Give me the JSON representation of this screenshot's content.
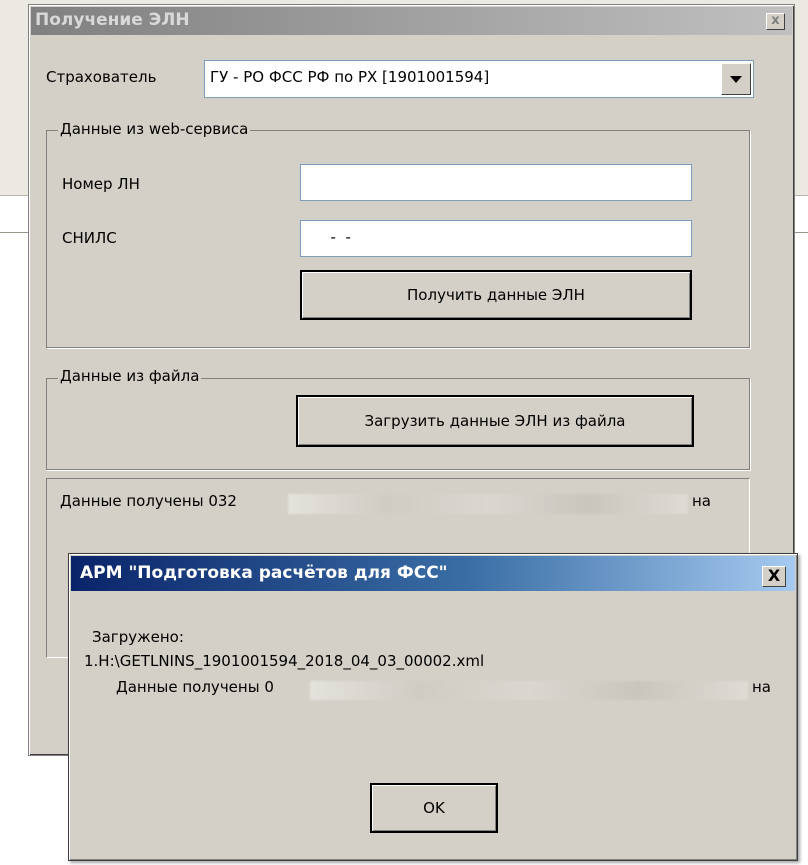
{
  "main_window": {
    "title": "Получение ЭЛН",
    "close_label": "x",
    "insurer": {
      "label": "Страхователь",
      "value": "ГУ - РО ФСС РФ по РХ [1901001594]"
    },
    "web_group": {
      "title": "Данные из web-сервиса",
      "ln_number_label": "Номер ЛН",
      "ln_number_value": "",
      "snils_label": "СНИЛС",
      "snils_value": "  -  -",
      "get_button": "Получить данные ЭЛН"
    },
    "file_group": {
      "title": "Данные из файла",
      "load_button": "Загрузить данные ЭЛН из файла"
    },
    "status": {
      "prefix": "Данные получены 032",
      "suffix": "на"
    }
  },
  "dialog": {
    "title": "АРМ \"Подготовка расчётов для ФСС\"",
    "close_label": "X",
    "line1": "Загружено:",
    "line2": "1.H:\\GETLNINS_1901001594_2018_04_03_00002.xml",
    "line3_prefix": "Данные получены 0",
    "line3_suffix": "на",
    "ok_label": "OK"
  }
}
